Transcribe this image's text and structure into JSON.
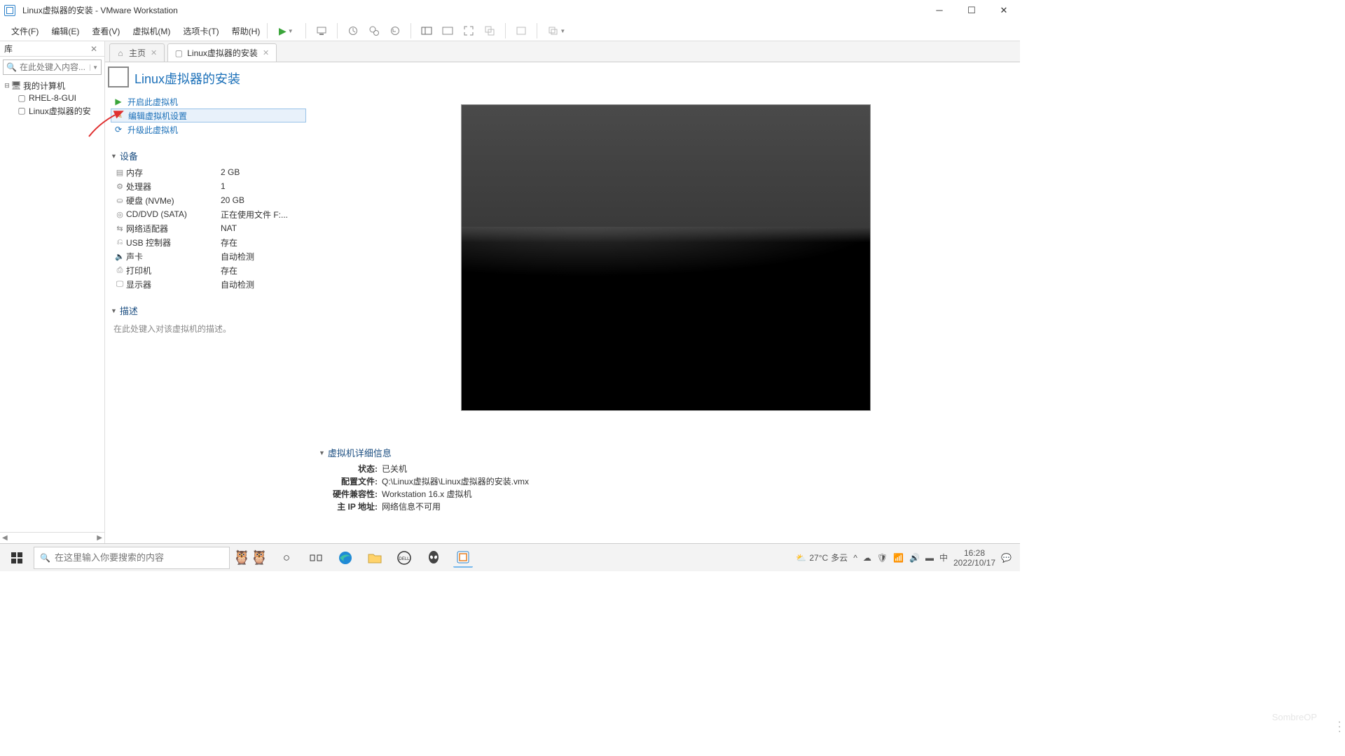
{
  "window": {
    "title": "Linux虚拟器的安装 - VMware Workstation"
  },
  "menus": [
    "文件(F)",
    "编辑(E)",
    "查看(V)",
    "虚拟机(M)",
    "选项卡(T)",
    "帮助(H)"
  ],
  "sidebar": {
    "title": "库",
    "search_placeholder": "在此处键入内容...",
    "root": "我的计算机",
    "items": [
      "RHEL-8-GUI",
      "Linux虚拟器的安"
    ]
  },
  "tabs": {
    "home": "主页",
    "vm": "Linux虚拟器的安装"
  },
  "page": {
    "title": "Linux虚拟器的安装",
    "actions": {
      "power_on": "开启此虚拟机",
      "edit_settings": "编辑虚拟机设置",
      "upgrade": "升级此虚拟机"
    },
    "devices_title": "设备",
    "devices": [
      {
        "label": "内存",
        "value": "2 GB",
        "icon": "mem"
      },
      {
        "label": "处理器",
        "value": "1",
        "icon": "cpu"
      },
      {
        "label": "硬盘 (NVMe)",
        "value": "20 GB",
        "icon": "disk"
      },
      {
        "label": "CD/DVD (SATA)",
        "value": "正在使用文件 F:...",
        "icon": "cd"
      },
      {
        "label": "网络适配器",
        "value": "NAT",
        "icon": "net"
      },
      {
        "label": "USB 控制器",
        "value": "存在",
        "icon": "usb"
      },
      {
        "label": "声卡",
        "value": "自动检测",
        "icon": "snd"
      },
      {
        "label": "打印机",
        "value": "存在",
        "icon": "prn"
      },
      {
        "label": "显示器",
        "value": "自动检测",
        "icon": "mon"
      }
    ],
    "desc_title": "描述",
    "desc_placeholder": "在此处键入对该虚拟机的描述。",
    "details_title": "虚拟机详细信息",
    "details": [
      {
        "k": "状态:",
        "v": "已关机"
      },
      {
        "k": "配置文件:",
        "v": "Q:\\Linux虚拟器\\Linux虚拟器的安装.vmx"
      },
      {
        "k": "硬件兼容性:",
        "v": "Workstation 16.x 虚拟机"
      },
      {
        "k": "主 IP 地址:",
        "v": "网络信息不可用"
      }
    ]
  },
  "taskbar": {
    "search_placeholder": "在这里输入你要搜索的内容",
    "weather_temp": "27°C",
    "weather_cond": "多云",
    "ime": "中",
    "time": "16:28",
    "date": "2022/10/17"
  },
  "watermark": "SombreOP"
}
